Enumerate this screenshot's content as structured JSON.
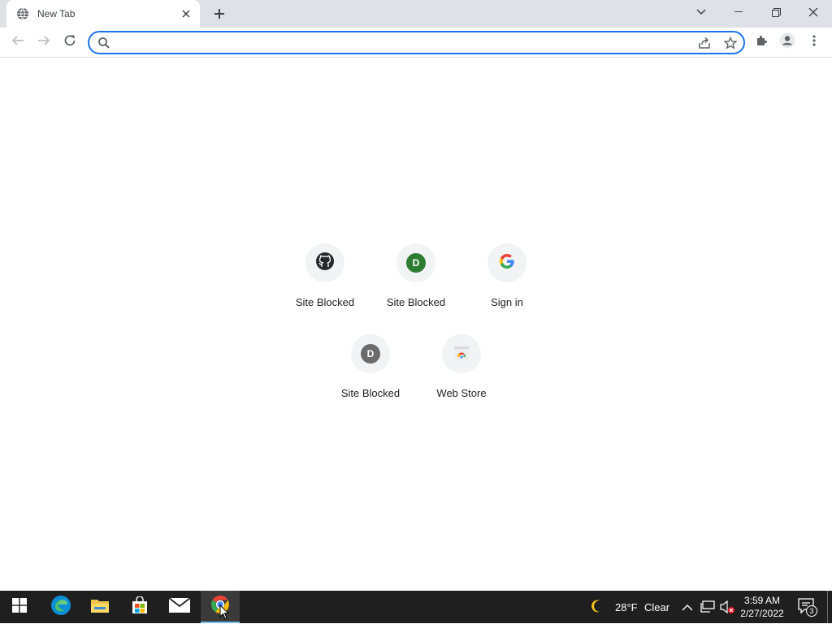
{
  "tab": {
    "title": "New Tab",
    "favicon": "globe-icon"
  },
  "window_controls": {
    "tab_search": "chevron-down-icon",
    "minimize": "minimize-icon",
    "restore": "restore-icon",
    "close": "close-icon"
  },
  "toolbar": {
    "back": "back-arrow-icon",
    "forward": "forward-arrow-icon",
    "reload": "reload-icon",
    "omnibox": {
      "value": "",
      "placeholder": ""
    },
    "share": "share-icon",
    "bookmark": "star-icon",
    "extensions": "puzzle-icon",
    "profile": "profile-icon",
    "menu": "kebab-menu-icon"
  },
  "shortcuts": [
    {
      "label": "Site Blocked",
      "icon": "github-icon"
    },
    {
      "label": "Site Blocked",
      "icon": "letter-d-icon",
      "letter": "D",
      "color": "#2e7d32"
    },
    {
      "label": "Sign in",
      "icon": "google-icon"
    },
    {
      "label": "Site Blocked",
      "icon": "letter-d-icon",
      "letter": "D",
      "color": "#6b6b6b"
    },
    {
      "label": "Web Store",
      "icon": "web-store-icon"
    }
  ],
  "taskbar": {
    "apps": [
      "windows-start-icon",
      "edge-icon",
      "file-explorer-icon",
      "store-icon",
      "mail-icon",
      "chrome-icon"
    ],
    "weather": {
      "temperature": "28°F",
      "condition": "Clear"
    },
    "clock": {
      "time": "3:59 AM",
      "date": "2/27/2022"
    },
    "notifications": {
      "count": "3"
    }
  },
  "colors": {
    "accent": "#1a73e8",
    "tabstrip": "#dee1e6",
    "taskbar": "#1f1f1f"
  }
}
